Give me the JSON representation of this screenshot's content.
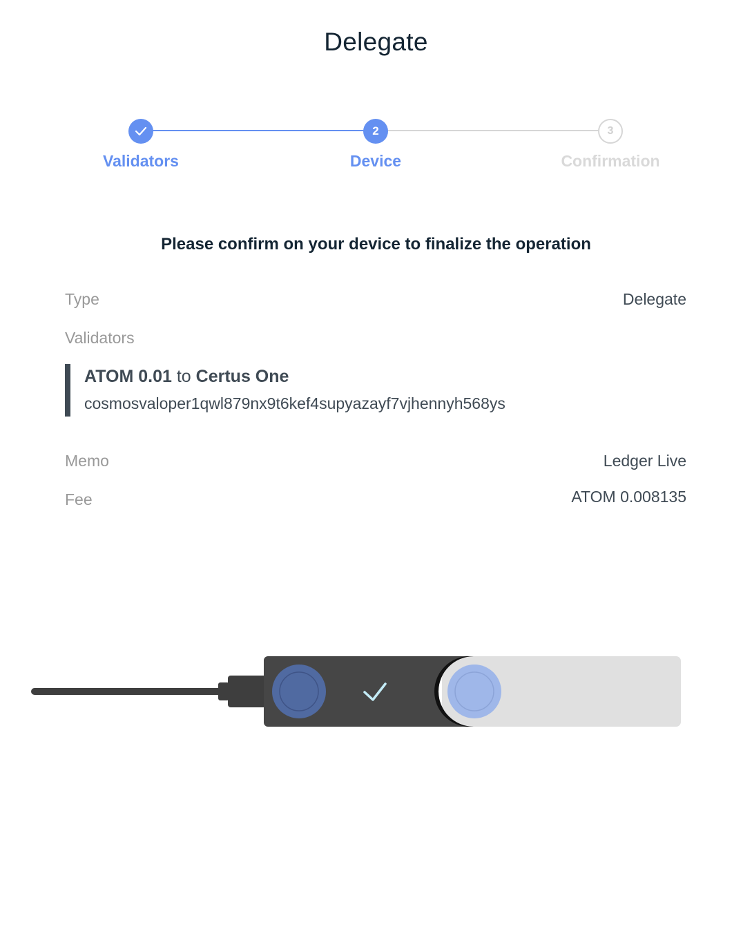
{
  "title": "Delegate",
  "stepper": {
    "steps": [
      {
        "label": "Validators",
        "number": "1",
        "state": "done"
      },
      {
        "label": "Device",
        "number": "2",
        "state": "active"
      },
      {
        "label": "Confirmation",
        "number": "3",
        "state": "pending"
      }
    ]
  },
  "confirm_message": "Please confirm on your device to finalize the operation",
  "details": {
    "type_label": "Type",
    "type_value": "Delegate",
    "validators_label": "Validators",
    "validator": {
      "amount": "ATOM 0.01",
      "connector": "to",
      "name": "Certus One",
      "address": "cosmosvaloper1qwl879nx9t6kef4supyazayf7vjhennyh568ys"
    },
    "memo_label": "Memo",
    "memo_value": "Ledger Live",
    "fee_label": "Fee",
    "fee_value": "ATOM 0.008135"
  },
  "device": {
    "icons": [
      "usb-cable-icon",
      "check-icon"
    ]
  },
  "colors": {
    "accent": "#6490f1",
    "text_dark": "#142533",
    "text_muted": "#999999",
    "step_pending": "#d6d6d6",
    "device_body": "#464646",
    "device_swivel": "#e0e0e0"
  }
}
